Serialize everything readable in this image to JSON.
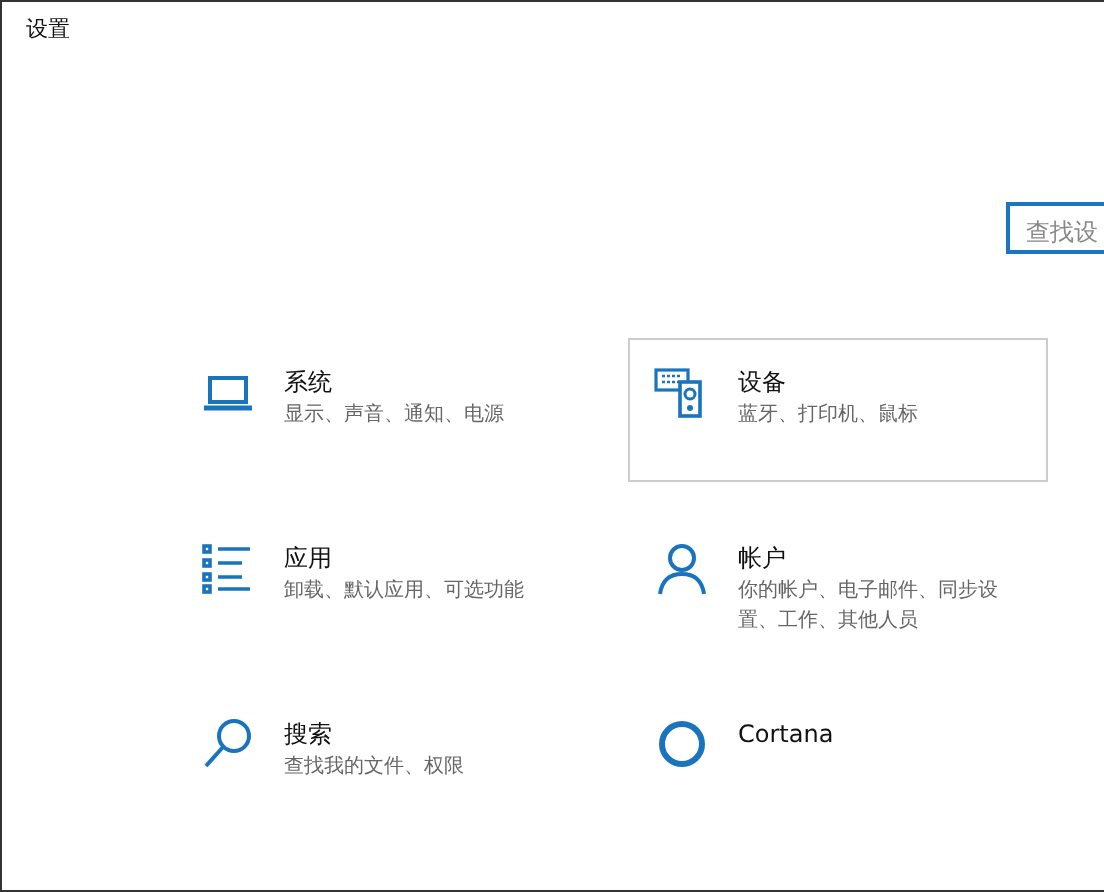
{
  "window": {
    "title": "设置"
  },
  "search": {
    "placeholder": "查找设"
  },
  "tiles": [
    {
      "kind": "system",
      "title": "系统",
      "description": "显示、声音、通知、电源",
      "hovered": false
    },
    {
      "kind": "devices",
      "title": "设备",
      "description": "蓝牙、打印机、鼠标",
      "hovered": true
    },
    {
      "kind": "apps",
      "title": "应用",
      "description": "卸载、默认应用、可选功能",
      "hovered": false
    },
    {
      "kind": "accounts",
      "title": "帐户",
      "description": "你的帐户、电子邮件、同步设置、工作、其他人员",
      "hovered": false
    },
    {
      "kind": "search",
      "title": "搜索",
      "description": "查找我的文件、权限",
      "hovered": false
    },
    {
      "kind": "cortana",
      "title": "Cortana",
      "hovered": false
    }
  ]
}
